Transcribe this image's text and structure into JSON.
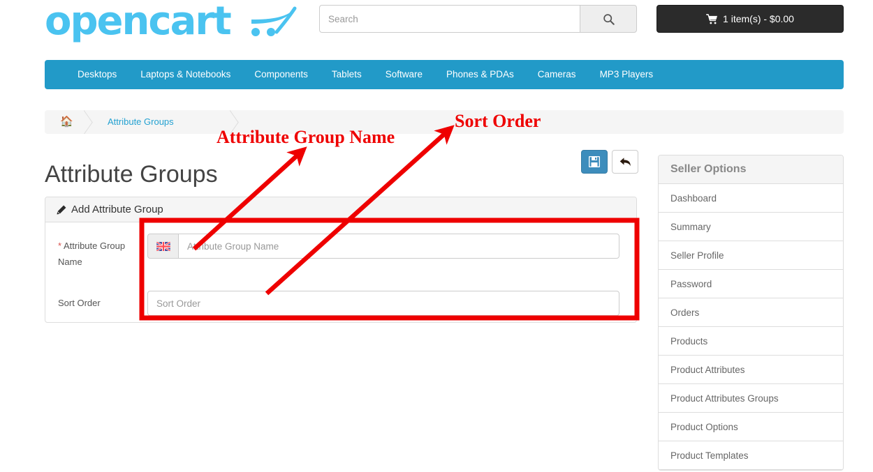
{
  "header": {
    "logo_text": "opencart",
    "logo_icon": "shopping-cart-swoosh-icon",
    "search": {
      "placeholder": "Search",
      "value": "",
      "button_icon": "search-icon"
    },
    "cart": {
      "icon": "shopping-cart-icon",
      "label": "1 item(s) - $0.00"
    }
  },
  "navbar": {
    "items": [
      {
        "label": "Desktops"
      },
      {
        "label": "Laptops & Notebooks"
      },
      {
        "label": "Components"
      },
      {
        "label": "Tablets"
      },
      {
        "label": "Software"
      },
      {
        "label": "Phones & PDAs"
      },
      {
        "label": "Cameras"
      },
      {
        "label": "MP3 Players"
      }
    ],
    "background_color": "#229ac8"
  },
  "breadcrumb": {
    "home_icon": "home-icon",
    "items": [
      {
        "label": "Attribute Groups"
      }
    ]
  },
  "page": {
    "title": "Attribute Groups",
    "save_icon": "floppy-disk-save-icon",
    "back_icon": "reply-back-arrow-icon"
  },
  "panel": {
    "header_icon": "pencil-icon",
    "header_title": "Add Attribute Group",
    "fields": [
      {
        "label": "Attribute Group Name",
        "required": true,
        "required_marker": "*",
        "addon_icon": "uk-flag-icon",
        "placeholder": "Attribute Group Name",
        "value": ""
      },
      {
        "label": "Sort Order",
        "required": false,
        "required_marker": "",
        "placeholder": "Sort Order",
        "value": ""
      }
    ]
  },
  "sidebar": {
    "title": "Seller Options",
    "items": [
      {
        "label": "Dashboard"
      },
      {
        "label": "Summary"
      },
      {
        "label": "Seller Profile"
      },
      {
        "label": "Password"
      },
      {
        "label": "Orders"
      },
      {
        "label": "Products"
      },
      {
        "label": "Product Attributes"
      },
      {
        "label": "Product Attributes Groups"
      },
      {
        "label": "Product Options"
      },
      {
        "label": "Product Templates"
      }
    ]
  },
  "annotations": {
    "color": "#ee0000",
    "name_label": "Attribute Group Name",
    "sort_label": "Sort Order"
  }
}
